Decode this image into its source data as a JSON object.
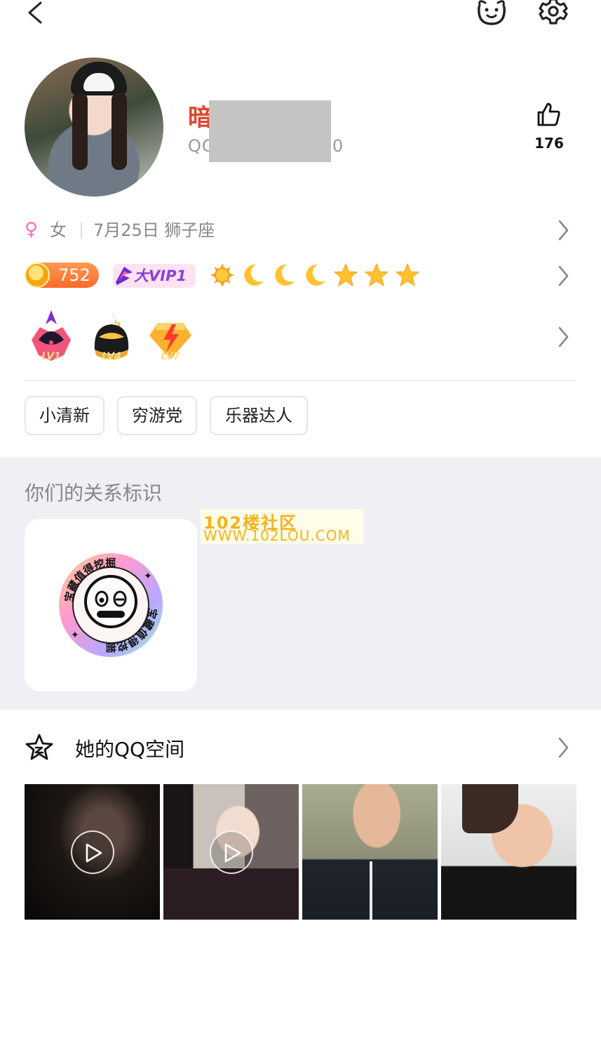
{
  "header": {
    "back_icon": "chevron-left-icon",
    "pet_icon": "pet-face-icon",
    "settings_icon": "gear-icon"
  },
  "profile": {
    "name_visible": "暗",
    "qq_prefix": "QC",
    "qq_suffix": "0",
    "likes": "176"
  },
  "info": {
    "gender_symbol": "♀",
    "gender": "女",
    "birthday": "7月25日 狮子座"
  },
  "badges": {
    "coin_value": "752",
    "vip_label": "大VIP1",
    "level_icons": [
      "sun",
      "moon",
      "moon",
      "moon",
      "star",
      "star",
      "star"
    ]
  },
  "medals": [
    "LV1",
    "LV4",
    "LV7"
  ],
  "tags": [
    "小清新",
    "穷游党",
    "乐器达人"
  ],
  "relation": {
    "title": "你们的关系标识",
    "badge_text": "宝藏值得挖掘"
  },
  "watermark": {
    "line1": "102楼社区",
    "line2": "WWW.102LOU.COM"
  },
  "qzone": {
    "label": "她的QQ空间"
  },
  "colors": {
    "name": "#e0442f",
    "section_bg": "#eff0f4",
    "vip": "#8a3fd8"
  }
}
